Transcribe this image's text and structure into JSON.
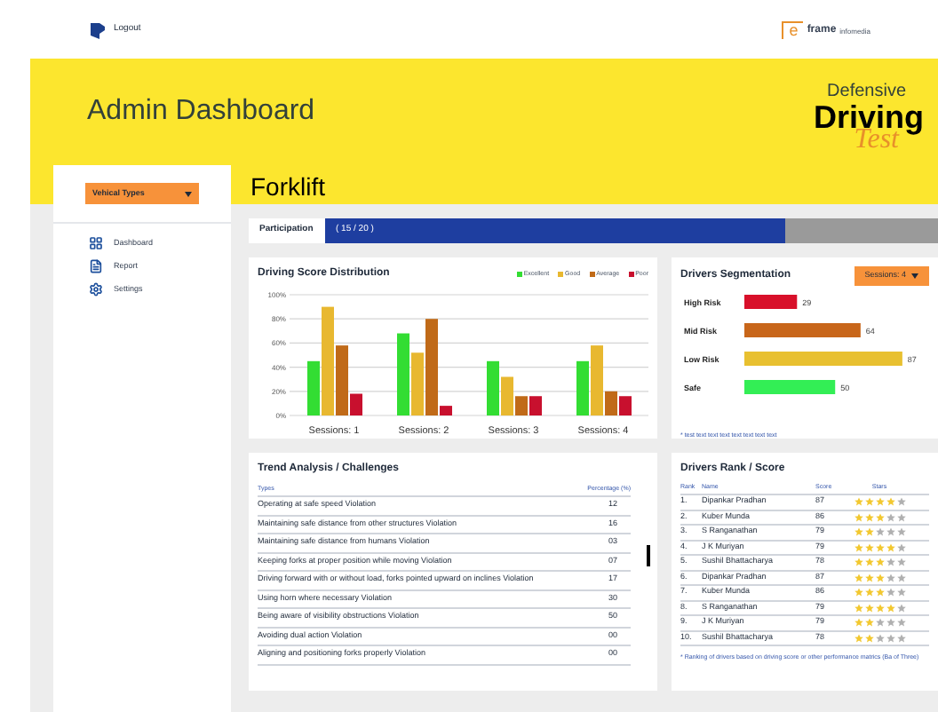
{
  "header": {
    "logout": "Logout",
    "brand": {
      "letter": "e",
      "name": "frame",
      "tagline": "infomedia"
    }
  },
  "banner": {
    "title": "Admin Dashboard",
    "logo": {
      "line1": "Defensive",
      "line2": "Driving",
      "line3": "Test"
    }
  },
  "sidebar": {
    "dropdown": "Vehical Types",
    "items": [
      {
        "label": "Dashboard"
      },
      {
        "label": "Report"
      },
      {
        "label": "Settings"
      }
    ]
  },
  "page_title": "Forklift",
  "participation": {
    "label": "Participation",
    "reading": "( 15 / 20 )",
    "level": 0.75
  },
  "score_distribution": {
    "title": "Driving Score Distribution",
    "chart_data": {
      "type": "bar",
      "grid": true,
      "categories": [
        "Sessions: 1",
        "Sessions: 2",
        "Sessions: 3",
        "Sessions: 4"
      ],
      "ylim": [
        0,
        100
      ],
      "yticks": [
        {
          "value": 0,
          "label": "0%"
        },
        {
          "value": 20,
          "label": "20%"
        },
        {
          "value": 40,
          "label": "40%"
        },
        {
          "value": 60,
          "label": "60%"
        },
        {
          "value": 80,
          "label": "80%"
        },
        {
          "value": 100,
          "label": "100%"
        }
      ],
      "series": [
        {
          "name": "Excellent",
          "color": "#33dd33",
          "values": [
            45,
            68,
            45,
            45
          ]
        },
        {
          "name": "Good",
          "color": "#e8b830",
          "values": [
            90,
            52,
            32,
            58
          ]
        },
        {
          "name": "Average",
          "color": "#c06a18",
          "values": [
            58,
            80,
            16,
            20
          ]
        },
        {
          "name": "Poor",
          "color": "#c8102e",
          "values": [
            18,
            8,
            16,
            16
          ]
        }
      ]
    }
  },
  "segmentation": {
    "title": "Drivers Segmentation",
    "dropdown": "Sessions: 4",
    "note": "* test text text text text text text text",
    "chart_data": {
      "type": "bar",
      "orientation": "horizontal",
      "data_labels": true,
      "categories": [
        "High Risk",
        "Mid Risk",
        "Low Risk",
        "Safe"
      ],
      "xlim": [
        0,
        90
      ],
      "stacked": true,
      "series": [
        {
          "color": "#d8102a",
          "values": [
            29,
            null,
            null,
            null
          ]
        },
        {
          "color": "#c8661a",
          "values": [
            null,
            64,
            null,
            null
          ]
        },
        {
          "color": "#e8c030",
          "values": [
            null,
            null,
            87,
            null
          ]
        },
        {
          "color": "#33ee55",
          "values": [
            null,
            null,
            null,
            50
          ]
        }
      ]
    }
  },
  "trend": {
    "title": "Trend Analysis / Challenges",
    "columns": [
      "Types",
      "Percentage (%)"
    ],
    "rows": [
      [
        "Operating at safe speed Violation",
        "12"
      ],
      [
        "Maintaining safe distance from other structures  Violation",
        "16"
      ],
      [
        "Maintaining safe distance from humans  Violation",
        "03"
      ],
      [
        "Keeping forks at proper position while moving  Violation",
        "07"
      ],
      [
        "Driving forward with or without load, forks pointed upward on inclines  Violation",
        "17"
      ],
      [
        "Using horn where necessary  Violation",
        "30"
      ],
      [
        "Being aware of visibility obstructions  Violation",
        "50"
      ],
      [
        "Avoiding dual action  Violation",
        "00"
      ],
      [
        "Aligning and positioning forks properly  Violation",
        "00"
      ]
    ]
  },
  "ranking": {
    "title": "Drivers Rank / Score",
    "columns": [
      "Rank",
      "Name",
      "Score",
      "Stars"
    ],
    "rows": [
      {
        "rank": "1.",
        "name": "Dipankar Pradhan",
        "score": "87",
        "stars": 4
      },
      {
        "rank": "2.",
        "name": "Kuber Munda",
        "score": "86",
        "stars": 3
      },
      {
        "rank": "3.",
        "name": "S Ranganathan",
        "score": "79",
        "stars": 2
      },
      {
        "rank": "4.",
        "name": "J K Muriyan",
        "score": "79",
        "stars": 4
      },
      {
        "rank": "5.",
        "name": "Sushil Bhattacharya",
        "score": "78",
        "stars": 3
      },
      {
        "rank": "6.",
        "name": "Dipankar Pradhan",
        "score": "87",
        "stars": 3
      },
      {
        "rank": "7.",
        "name": "Kuber Munda",
        "score": "86",
        "stars": 3
      },
      {
        "rank": "8.",
        "name": "S Ranganathan",
        "score": "79",
        "stars": 4
      },
      {
        "rank": "9.",
        "name": "J K Muriyan",
        "score": "79",
        "stars": 2
      },
      {
        "rank": "10.",
        "name": "Sushil Bhattacharya",
        "score": "78",
        "stars": 2
      }
    ],
    "note": "* Ranking of drivers based on driving score or other performance matrics (Ba of Three)"
  }
}
